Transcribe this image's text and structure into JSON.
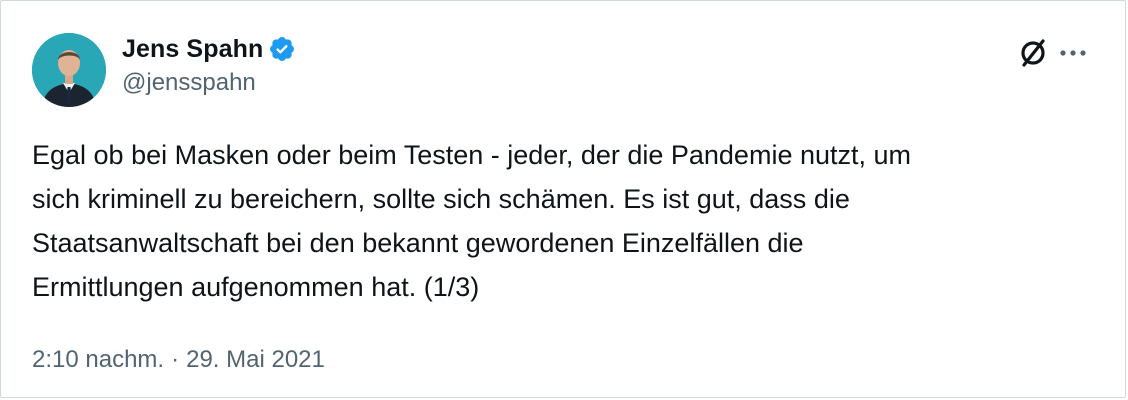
{
  "author": {
    "display_name": "Jens Spahn",
    "handle": "@jensspahn",
    "verified_color": "#1d9bf0"
  },
  "tweet": {
    "text": "Egal ob bei Masken oder beim Testen - jeder, der die Pandemie nutzt, um\nsich kriminell zu bereichern, sollte sich schämen. Es ist gut, dass die\nStaatsanwaltschaft bei den bekannt gewordenen Einzelfällen die\nErmittlungen aufgenommen hat. (1/3)",
    "time": "2:10 nachm.",
    "separator": "·",
    "date": "29. Mai 2021"
  },
  "icons": {
    "logo": "x-logo-icon",
    "more": "more-options-icon",
    "verified": "verified-badge-icon"
  },
  "colors": {
    "text_primary": "#0f1419",
    "text_secondary": "#536471",
    "border": "#cfd9de",
    "accent": "#1d9bf0"
  }
}
